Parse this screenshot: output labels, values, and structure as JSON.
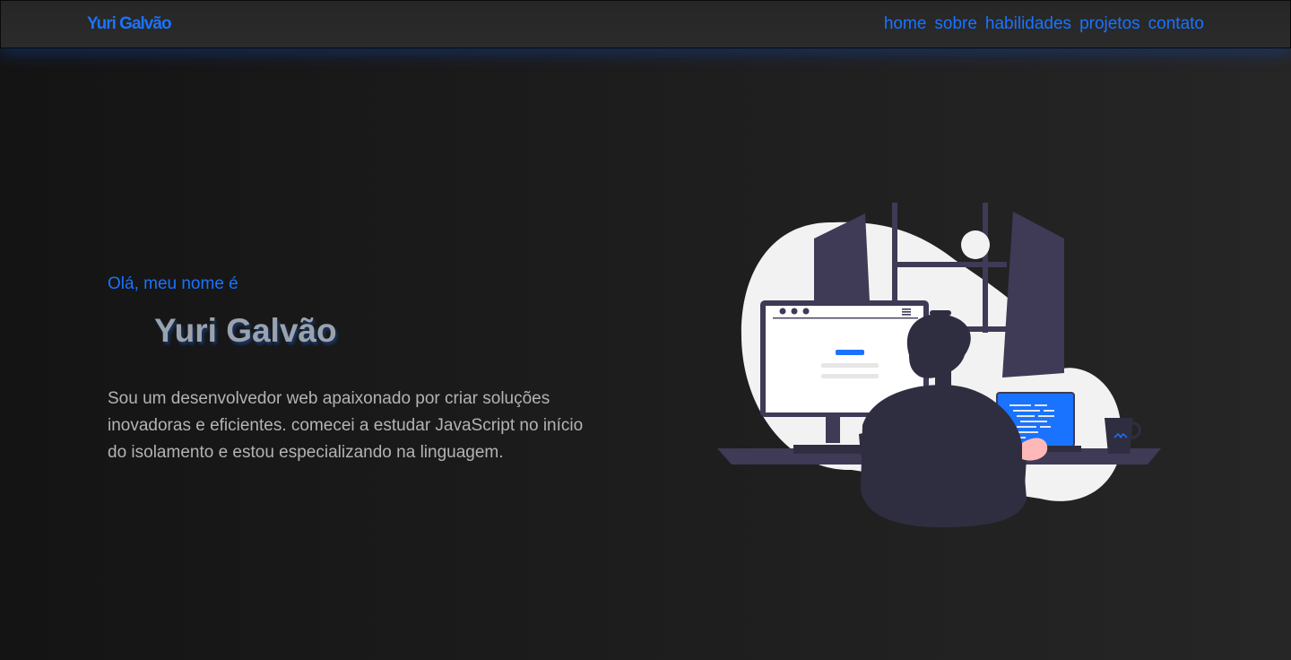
{
  "header": {
    "logo": "Yuri Galvão",
    "nav": [
      "home",
      "sobre",
      "habilidades",
      "projetos",
      "contato"
    ]
  },
  "hero": {
    "greeting": "Olá, meu nome é",
    "name": "Yuri Galvão",
    "description": "Sou um desenvolvedor web apaixonado por criar soluções inovadoras e eficientes. comecei a estudar JavaScript no início do isolamento e estou especializando na linguagem."
  },
  "colors": {
    "accent": "#1a73ff",
    "background": "#1a1a1a",
    "header": "#292929",
    "name_text": "#9aa3ad",
    "body_text": "#b3b3b3",
    "illustration_dark": "#3f3a56",
    "illustration_light": "#f2f2f2"
  },
  "illustration": {
    "name": "developer-at-desk-illustration"
  }
}
